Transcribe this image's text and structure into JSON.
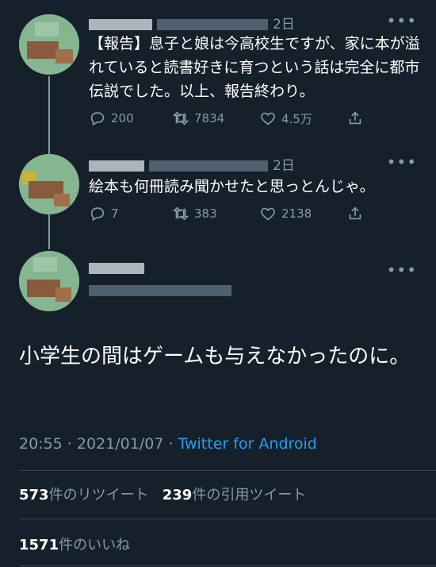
{
  "tweets": [
    {
      "time": "2日",
      "text": "【報告】息子と娘は今高校生ですが、家に本が溢れていると読書好きに育つという話は完全に都市伝説でした。以上、報告終わり。",
      "replies": "200",
      "retweets": "7834",
      "likes": "4.5万"
    },
    {
      "time": "2日",
      "text": "絵本も何冊読み聞かせたと思っとんじゃ。",
      "replies": "7",
      "retweets": "383",
      "likes": "2138"
    }
  ],
  "main": {
    "text": "小学生の間はゲームも与えなかったのに。",
    "timestamp": "20:55 · 2021/01/07 · ",
    "source": "Twitter for Android",
    "retweets_count": "573",
    "retweets_label": "件のリツイート",
    "quotes_count": "239",
    "quotes_label": "件の引用ツイート",
    "likes_count": "1571",
    "likes_label": "件のいいね"
  },
  "icons": [
    "reply-icon",
    "retweet-icon",
    "like-icon",
    "share-icon",
    "more-icon"
  ],
  "colors": {
    "background": "#15202b",
    "muted": "#8899a6",
    "link": "#1da1f2",
    "divider": "#38444d"
  }
}
